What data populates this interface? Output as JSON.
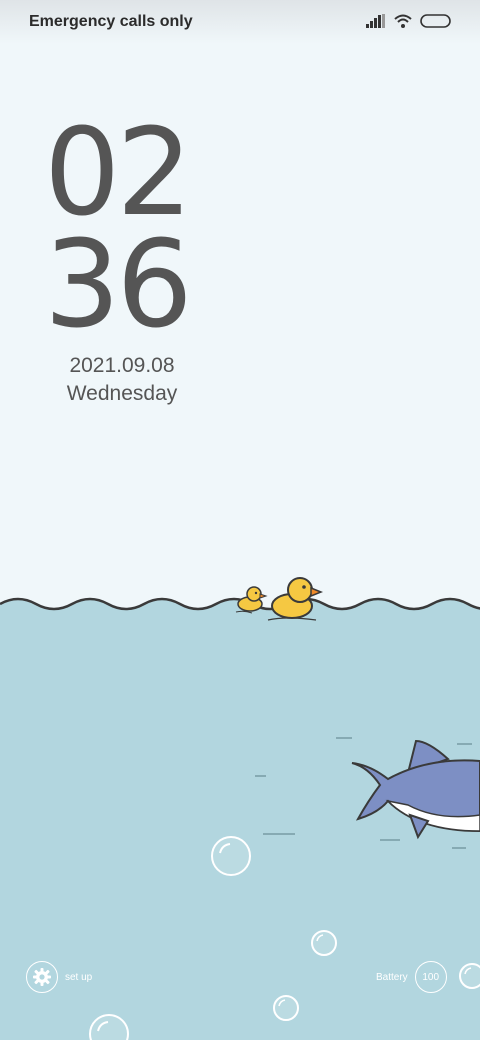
{
  "status_bar": {
    "carrier": "Emergency calls only",
    "icons": [
      "signal-icon",
      "wifi-icon",
      "battery-icon"
    ]
  },
  "clock": {
    "hours": "02",
    "minutes": "36"
  },
  "date": {
    "date": "2021.09.08",
    "weekday": "Wednesday"
  },
  "bottom": {
    "setup_label": "set up",
    "battery_label": "Battery",
    "battery_value": "100"
  },
  "colors": {
    "sky": "#f0f7fa",
    "sea": "#b2d6df",
    "text": "#555555",
    "duck": "#f5c842",
    "shark": "#7d8fc4"
  }
}
